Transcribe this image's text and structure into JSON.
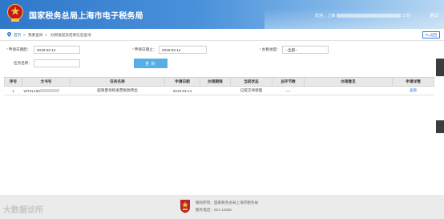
{
  "header": {
    "title": "国家税务总局上海市电子税务局",
    "welcome_prefix": "欢迎，上海",
    "welcome_suffix": "公司",
    "exit_label": "退出"
  },
  "breadcrumb": {
    "home": "首页",
    "sep1": ">",
    "item1": "我要查询",
    "sep2": ">",
    "item2": "办税进度及结果信息查询",
    "back_label": "返回"
  },
  "form": {
    "start_date_label": "申请日期起：",
    "start_date_value": "2019-03-14",
    "end_date_label": "申请日期止：",
    "end_date_value": "2019-03-14",
    "progress_label": "办税进度：",
    "progress_value": "--全部--",
    "task_name_label": "任务名称：",
    "task_name_value": "",
    "query_label": "查询"
  },
  "table": {
    "columns": [
      "序号",
      "文书号",
      "任务名称",
      "申请日期",
      "办理期限",
      "当前状态",
      "总环节数",
      "办理意见",
      "申请详情"
    ],
    "rows": [
      {
        "index": "1",
        "doc_no": "WTSL190",
        "task": "超限量领购发票税款转出",
        "date": "2019-03-14",
        "deadline": "",
        "status": "已提交待受理",
        "steps": "----",
        "opinion": "",
        "detail": "查看"
      }
    ]
  },
  "footer": {
    "line1": "版权所有：国家税务总局上海市税务局",
    "line2": "服务电话：021-12366"
  },
  "watermark": "大数据诊所"
}
